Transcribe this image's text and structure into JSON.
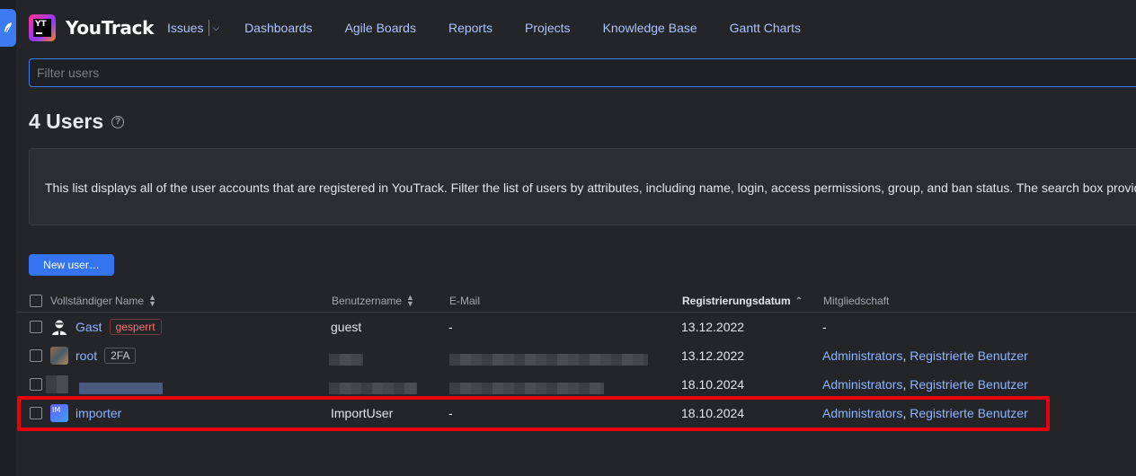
{
  "app": {
    "name": "YouTrack",
    "logo_initials": "YT"
  },
  "nav": {
    "issues": "Issues",
    "items": [
      "Dashboards",
      "Agile Boards",
      "Reports",
      "Projects",
      "Knowledge Base",
      "Gantt Charts"
    ]
  },
  "filter": {
    "placeholder": "Filter users",
    "value": ""
  },
  "page": {
    "title": "4 Users",
    "help_icon": "?"
  },
  "info": {
    "text": "This list displays all of the user accounts that are registered in YouTrack. Filter the list of users by attributes, including name, login, access permissions, group, and ban status. The search box provides"
  },
  "toolbar": {
    "new_user_label": "New user…"
  },
  "table": {
    "headers": {
      "full_name": "Vollständiger Name",
      "username": "Benutzername",
      "email": "E-Mail",
      "registered": "Registrierungsdatum",
      "membership": "Mitgliedschaft"
    },
    "sorted_by": "registered",
    "sort_direction": "ascending",
    "rows": [
      {
        "name": "Gast",
        "badge": "gesperrt",
        "username": "guest",
        "email": "-",
        "registered": "13.12.2022",
        "membership": "-",
        "membership_groups": []
      },
      {
        "name": "root",
        "badge": "2FA",
        "username": "",
        "email": "",
        "registered": "13.12.2022",
        "membership_groups": [
          "Administrators",
          "Registrierte Benutzer"
        ],
        "redacted": [
          "username",
          "email"
        ]
      },
      {
        "name": "",
        "badge": "",
        "username": "",
        "email": "",
        "registered": "18.10.2024",
        "membership_groups": [
          "Administrators",
          "Registrierte Benutzer"
        ],
        "redacted": [
          "name",
          "username",
          "email"
        ]
      },
      {
        "name": "importer",
        "avatar_initials": "IM",
        "badge": "",
        "username": "ImportUser",
        "email": "-",
        "registered": "18.10.2024",
        "membership_groups": [
          "Administrators",
          "Registrierte Benutzer"
        ],
        "highlighted": true
      }
    ]
  },
  "colors": {
    "background": "#232529",
    "accent": "#3574f0",
    "link": "#8fb3ff",
    "highlight": "#e8000b",
    "banned_badge": "#f27676"
  },
  "icons": [
    "feather-icon",
    "help-icon",
    "sort-icon",
    "guest-avatar-icon"
  ]
}
